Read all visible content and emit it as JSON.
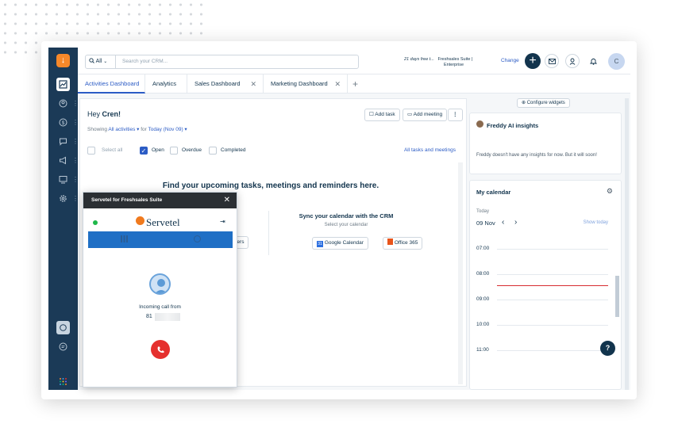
{
  "search": {
    "scope": "All",
    "placeholder": "Search your CRM..."
  },
  "trial": {
    "line1": "21 days free t...",
    "line2": "Freshsales Suite |",
    "line3": "Enterprise",
    "change_label": "Change"
  },
  "user": {
    "initial": "C"
  },
  "tabs": [
    {
      "label": "Activities Dashboard"
    },
    {
      "label": "Analytics"
    },
    {
      "label": "Sales Dashboard"
    },
    {
      "label": "Marketing Dashboard"
    }
  ],
  "main": {
    "greeting": "Hey",
    "name": "Cren!",
    "showing_label": "Showing",
    "showing_value": "All activities",
    "for_label": "for",
    "for_value": "Today (Nov 09)",
    "add_task": "Add task",
    "add_meeting": "Add meeting",
    "filters": {
      "select_all": "Select all",
      "open": "Open",
      "overdue": "Overdue",
      "completed": "Completed"
    },
    "all_tasks_link": "All tasks and meetings",
    "empty_title": "Find your upcoming tasks, meetings and reminders here.",
    "partial_button": "thers",
    "sync_title": "Sync your calendar with the CRM",
    "sync_sub": "Select your calendar",
    "google_calendar": "Google Calendar",
    "office_365": "Office 365"
  },
  "right": {
    "configure": "Configure widgets",
    "freddy_title": "Freddy AI insights",
    "freddy_text": "Freddy doesn't have any insights for now. But it will soon!",
    "calendar_title": "My calendar",
    "today": "Today",
    "date": "09 Nov",
    "show_today": "Show today",
    "times": [
      "07:00",
      "08:00",
      "09:00",
      "10:00",
      "11:00"
    ],
    "help": "?"
  },
  "popup": {
    "title": "Servetel for Freshsales Suite",
    "brand": "Servetel",
    "incoming": "Incoming call from",
    "number_prefix": "81"
  },
  "colors": {
    "sidebar": "#1b3a57",
    "accent": "#2c5cc5",
    "brand_orange": "#f6882a",
    "hangup": "#e5302e",
    "current_time": "#d72d30"
  }
}
